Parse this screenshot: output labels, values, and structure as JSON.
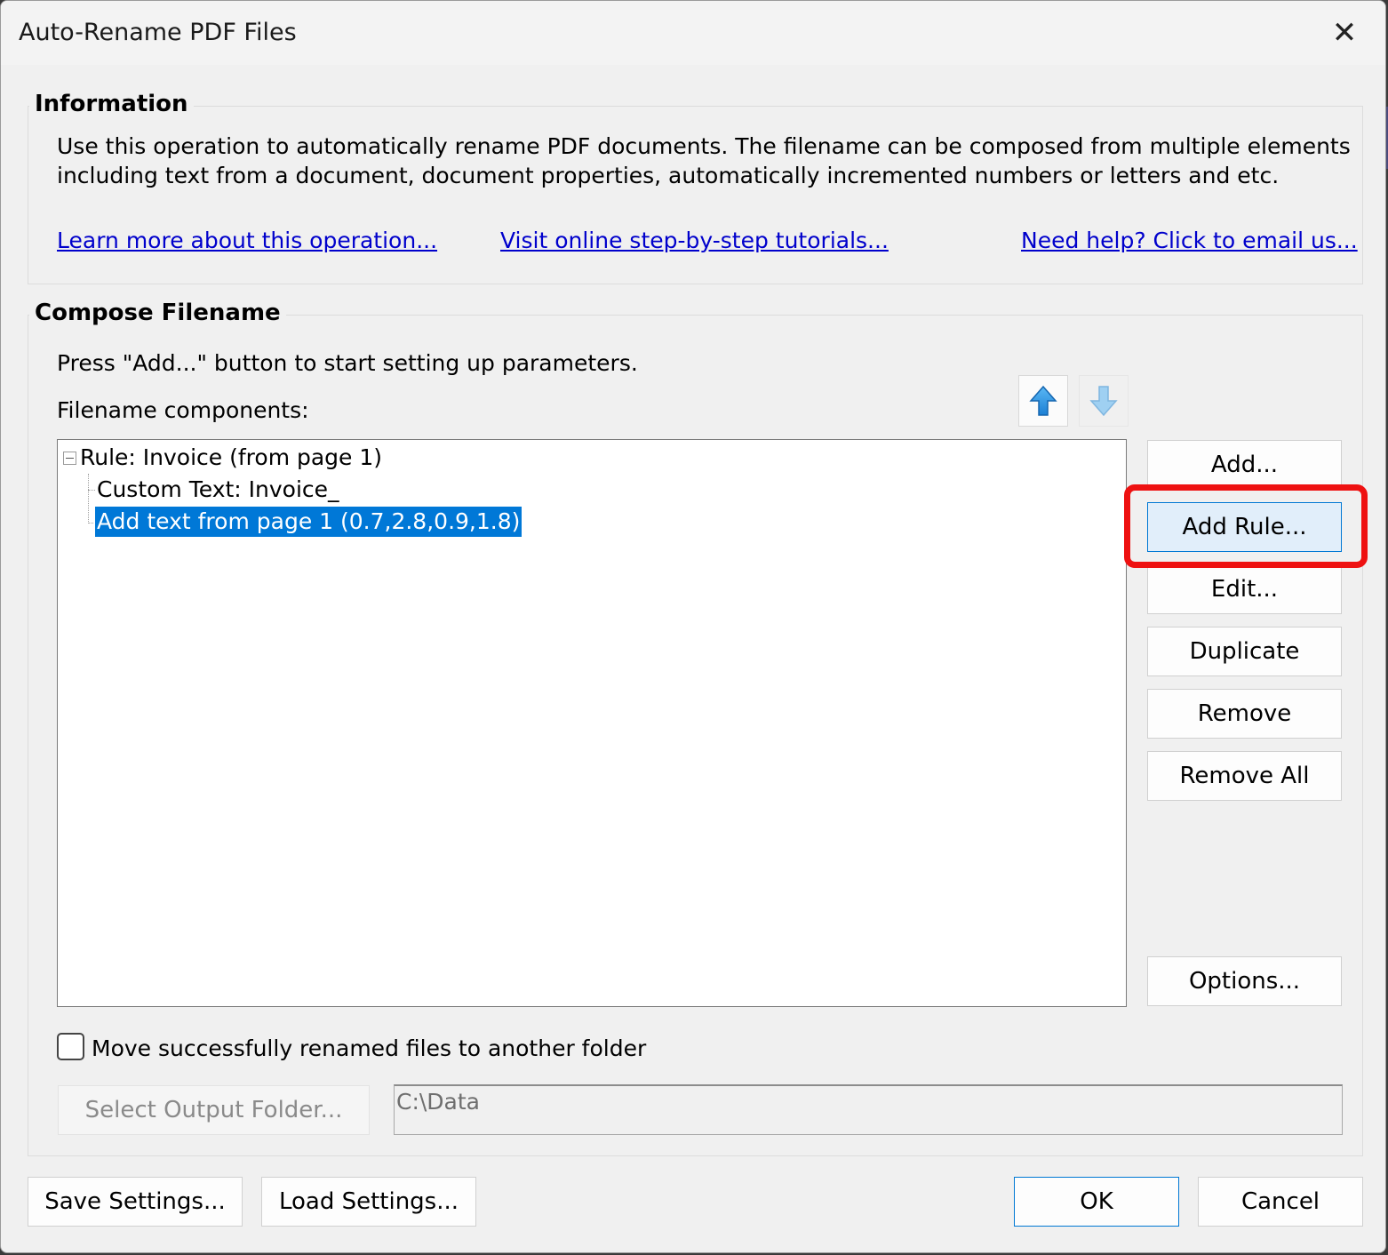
{
  "window": {
    "title": "Auto-Rename PDF Files",
    "close_icon": "✕"
  },
  "information": {
    "heading": "Information",
    "description_line1": "Use this operation to automatically rename PDF documents. The filename can be composed from multiple elements",
    "description_line2": "including text from a document, document properties, automatically incremented numbers or letters and etc.",
    "links": {
      "learn_more": "Learn more about this operation...",
      "tutorials": "Visit online step-by-step tutorials...",
      "help": "Need help? Click to email us..."
    }
  },
  "compose": {
    "heading": "Compose Filename",
    "instruction": "Press \"Add...\" button to start setting up parameters.",
    "components_label": "Filename components:",
    "tree": {
      "rule": "Rule: Invoice (from page 1)",
      "child1": "Custom Text: Invoice_",
      "child2": "Add text from page 1 (0.7,2.8,0.9,1.8)"
    },
    "buttons": {
      "add": "Add...",
      "add_rule": "Add Rule...",
      "edit": "Edit...",
      "duplicate": "Duplicate",
      "remove": "Remove",
      "remove_all": "Remove All",
      "options": "Options..."
    },
    "move_checkbox_label": "Move successfully renamed files to another folder",
    "select_output_folder": "Select Output Folder...",
    "output_path": "C:\\Data"
  },
  "footer": {
    "save_settings": "Save Settings...",
    "load_settings": "Load Settings...",
    "ok": "OK",
    "cancel": "Cancel"
  },
  "colors": {
    "accent": "#0078d4",
    "selection": "#0078d7",
    "highlight": "#ee1111",
    "link": "#0000cc"
  }
}
